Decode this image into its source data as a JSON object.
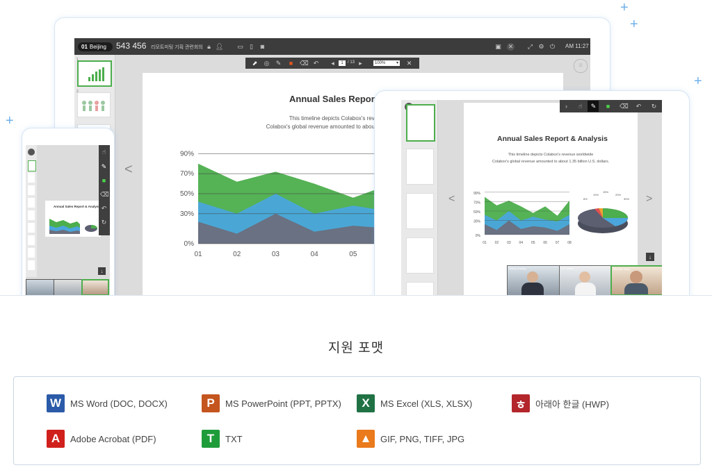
{
  "laptop": {
    "room_number": "01",
    "location": "Beijing",
    "meeting_id": "543 456",
    "meeting_title": "리모트미팅 기획 관련회의",
    "time": "AM 11:27",
    "page_current": "1",
    "page_total": "/ 13",
    "zoom": "100%"
  },
  "slide": {
    "title": "Annual Sales Report & Analysis",
    "desc_line1": "This timeline depicts Colabox's revenue worldwide",
    "desc_line2": "Colabox's global revenue amounted to about 1.35 billion U.S. dollars."
  },
  "chart_data": {
    "type": "area",
    "categories": [
      "01",
      "02",
      "03",
      "04",
      "05",
      "06",
      "07",
      "08"
    ],
    "y_ticks": [
      "90%",
      "70%",
      "50%",
      "30%",
      "0%"
    ],
    "ylim": [
      0,
      100
    ],
    "series": [
      {
        "color": "#6a6e7d",
        "values": [
          22,
          10,
          30,
          12,
          18,
          15,
          8,
          22
        ]
      },
      {
        "color": "#4aa6dc",
        "values": [
          42,
          30,
          50,
          30,
          38,
          32,
          28,
          42
        ]
      },
      {
        "color": "#4cae4c",
        "values": [
          80,
          62,
          72,
          60,
          46,
          60,
          40,
          72
        ]
      }
    ]
  },
  "tablet_chart_data": {
    "type": "area",
    "categories": [
      "01",
      "02",
      "03",
      "04",
      "05",
      "06",
      "07",
      "08"
    ],
    "y_ticks": [
      "90%",
      "70%",
      "50%",
      "30%",
      "0%"
    ],
    "ylim": [
      0,
      100
    ],
    "pie_labels": [
      "8%",
      "10%",
      "15%",
      "20%",
      "30%"
    ]
  },
  "tablet_participants": [
    "Wang Jinping",
    "Lin Nanfei",
    "Michael Jang"
  ],
  "section": {
    "heading": "지원 포맷"
  },
  "formats": [
    {
      "label": "MS Word (DOC, DOCX)",
      "icon": "word-icon",
      "letter": "W",
      "color": "#2b5aa8"
    },
    {
      "label": "MS PowerPoint (PPT, PPTX)",
      "icon": "powerpoint-icon",
      "letter": "P",
      "color": "#c4551f"
    },
    {
      "label": "MS Excel (XLS, XLSX)",
      "icon": "excel-icon",
      "letter": "X",
      "color": "#207245"
    },
    {
      "label": "아래아 한글 (HWP)",
      "icon": "hwp-icon",
      "letter": "ㅎ",
      "color": "#b3262b"
    },
    {
      "label": "Adobe Acrobat (PDF)",
      "icon": "pdf-icon",
      "letter": "A",
      "color": "#d0201c"
    },
    {
      "label": "TXT",
      "icon": "txt-icon",
      "letter": "T",
      "color": "#1f9c3a"
    },
    {
      "label": "GIF, PNG, TIFF, JPG",
      "icon": "image-icon",
      "letter": "▲",
      "color": "#ea7a1c"
    }
  ]
}
